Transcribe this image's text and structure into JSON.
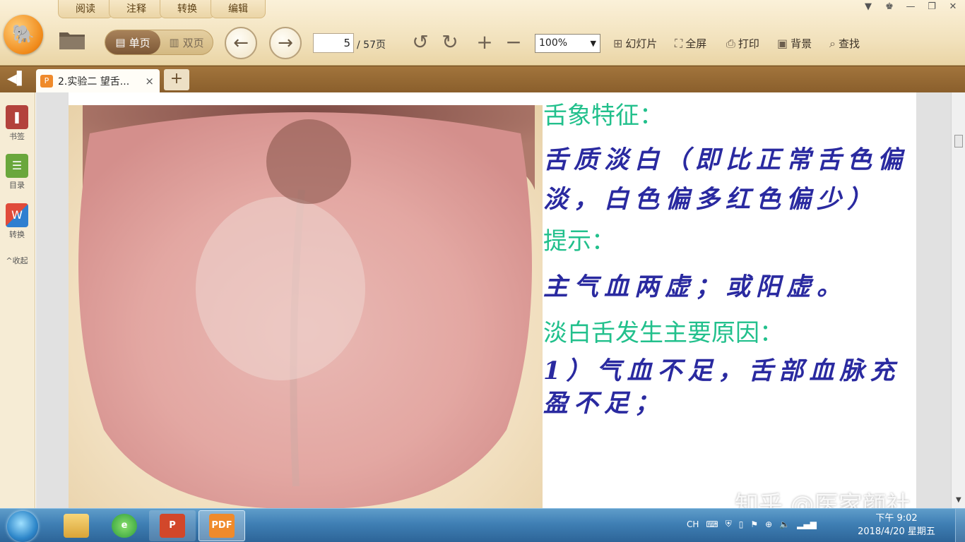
{
  "menu": {
    "tabs": [
      "阅读",
      "注释",
      "转换",
      "编辑"
    ]
  },
  "toolbar": {
    "single_page": "单页",
    "double_page": "双页",
    "page_current": "5",
    "page_total": "/ 57页",
    "zoom": "100%",
    "slideshow": "幻灯片",
    "fullscreen": "全屏",
    "print": "打印",
    "background": "背景",
    "find": "查找"
  },
  "tab": {
    "title": "2.实验二 望舌...",
    "close": "×",
    "new": "+"
  },
  "sidebar": {
    "bookmark": "书签",
    "toc": "目录",
    "convert": "转换",
    "collapse": "收起"
  },
  "document": {
    "heading1": "舌象特征：",
    "body1": "舌质淡白（即比正常舌色偏淡，白色偏多红色偏少）",
    "heading2": "提示：",
    "body2": "主气血两虚；或阳虚。",
    "heading3": "淡白舌发生主要原因：",
    "body3": "1）气血不足，舌部血脉充盈不足；"
  },
  "watermark": "知乎 @医家颜社",
  "taskbar": {
    "apps": [
      "windows-explorer",
      "ie-browser",
      "powerpoint",
      "pdf-reader"
    ],
    "tray": {
      "lang": "CH"
    },
    "clock_time": "下午 9:02",
    "clock_date": "2018/4/20 星期五"
  },
  "colors": {
    "heading": "#22c08c",
    "body": "#2a2aa0",
    "accent": "#ef8a2b"
  }
}
